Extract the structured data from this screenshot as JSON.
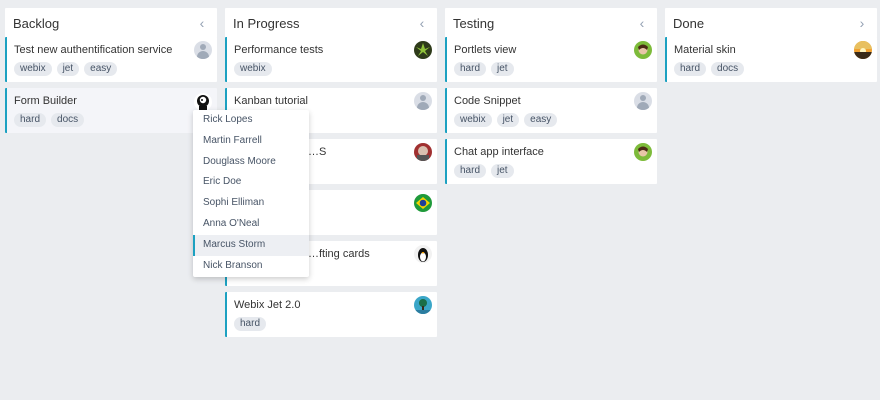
{
  "columns": [
    {
      "title": "Backlog",
      "arrow": "‹",
      "cards": [
        {
          "title": "Test new authentification service",
          "tags": [
            "webix",
            "jet",
            "easy"
          ],
          "avatar": "user-placeholder"
        },
        {
          "title": "Form Builder",
          "tags": [
            "hard",
            "docs"
          ],
          "avatar": "user-black-white"
        }
      ]
    },
    {
      "title": "In Progress",
      "arrow": "‹",
      "cards": [
        {
          "title": "Performance tests",
          "tags": [
            "webix"
          ],
          "avatar": "user-green-leaf"
        },
        {
          "title": "Kanban tutorial",
          "tags": [],
          "avatar": "user-placeholder"
        },
        {
          "title": "…S",
          "tags": [],
          "avatar": "user-red-grey"
        },
        {
          "title": "",
          "tags": [],
          "avatar": "user-brazil-flag"
        },
        {
          "title": "…fting cards",
          "tags": [],
          "avatar": "user-penguin"
        },
        {
          "title": "Webix Jet 2.0",
          "tags": [
            "hard"
          ],
          "avatar": "user-teal-tree"
        }
      ]
    },
    {
      "title": "Testing",
      "arrow": "‹",
      "cards": [
        {
          "title": "Portlets view",
          "tags": [
            "hard",
            "jet"
          ],
          "avatar": "user-green-girl"
        },
        {
          "title": "Code Snippet",
          "tags": [
            "webix",
            "jet",
            "easy"
          ],
          "avatar": "user-placeholder"
        },
        {
          "title": "Chat app interface",
          "tags": [
            "hard",
            "jet"
          ],
          "avatar": "user-green-girl"
        }
      ]
    },
    {
      "title": "Done",
      "arrow": "›",
      "cards": [
        {
          "title": "Material skin",
          "tags": [
            "hard",
            "docs"
          ],
          "avatar": "user-sunset"
        }
      ]
    }
  ],
  "assignee_dropdown": {
    "options": [
      "Rick Lopes",
      "Martin Farrell",
      "Douglass Moore",
      "Eric Doe",
      "Sophi Elliman",
      "Anna O'Neal",
      "Marcus Storm",
      "Nick Branson"
    ],
    "highlighted": "Marcus Storm"
  },
  "colors": {
    "accent": "#1ca1c1",
    "background": "#ebedf0",
    "tag_bg": "#e6e9ee"
  }
}
